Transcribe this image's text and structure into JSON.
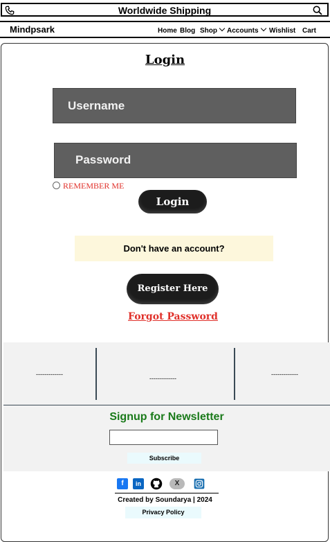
{
  "topbar": {
    "title": "Worldwide Shipping",
    "phone_icon": "phone-icon",
    "search_icon": "search-icon"
  },
  "navbar": {
    "brand": "Mindpsark",
    "items": [
      {
        "label": "Home"
      },
      {
        "label": "Blog"
      },
      {
        "label": "Shop",
        "dropdown": true
      },
      {
        "label": "Accounts",
        "dropdown": true
      },
      {
        "label": "Wishlist"
      },
      {
        "label": "Cart"
      }
    ]
  },
  "login": {
    "title": "Login",
    "username_placeholder": "Username",
    "password_placeholder": "Password",
    "remember_label": "REMEMBER ME",
    "login_button": "Login",
    "no_account_text": "Don't have an account?",
    "register_button": "Register Here",
    "forgot_link": "Forgot Password"
  },
  "footer": {
    "columns": [
      "-------------",
      "-------------",
      "-------------"
    ],
    "newsletter": {
      "title": "Signup for Newsletter",
      "input_value": "",
      "subscribe_label": "Subscribe"
    },
    "socials": [
      {
        "name": "facebook-icon",
        "glyph": "f",
        "color": "#1877f2"
      },
      {
        "name": "linkedin-icon",
        "glyph": "in",
        "color": "#0a66c2"
      },
      {
        "name": "github-icon",
        "glyph": "",
        "color": "#000000"
      },
      {
        "name": "x-icon",
        "glyph": "X",
        "color": "#9a9a9a"
      },
      {
        "name": "instagram-icon",
        "glyph": "",
        "color": "#1a6fb0"
      }
    ],
    "credit": "Created by Soundarya | 2024",
    "privacy": "Privacy Policy"
  },
  "colors": {
    "accent_red": "#e0302a",
    "newsletter_green": "#1a7a1a",
    "button_dark": "#1c1c1c",
    "field_gray": "#5f5f5f"
  }
}
